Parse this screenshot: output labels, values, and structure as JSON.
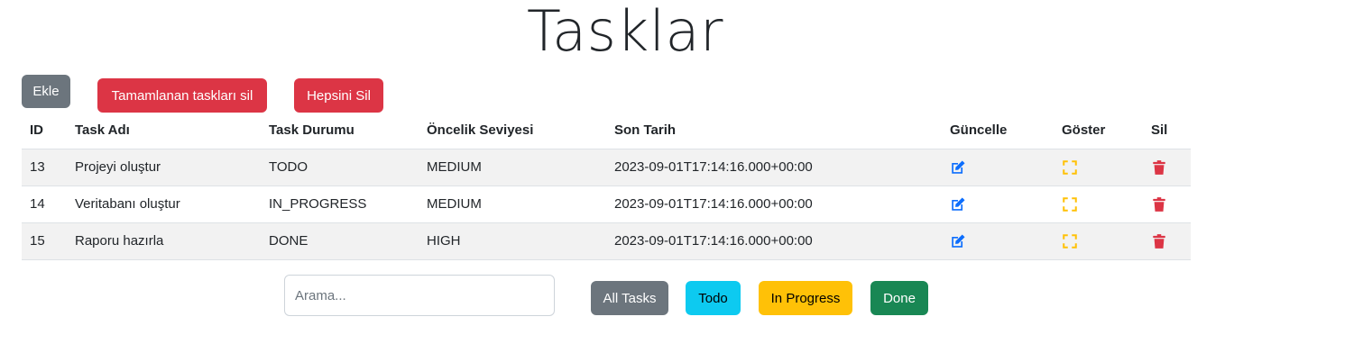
{
  "page": {
    "title": "Tasklar"
  },
  "toolbar": {
    "add_label": "Ekle",
    "delete_completed_label": "Tamamlanan taskları sil",
    "delete_all_label": "Hepsini Sil"
  },
  "table": {
    "headers": [
      "ID",
      "Task Adı",
      "Task Durumu",
      "Öncelik Seviyesi",
      "Son Tarih",
      "Güncelle",
      "Göster",
      "Sil"
    ],
    "rows": [
      {
        "id": "13",
        "name": "Projeyi oluştur",
        "status": "TODO",
        "priority": "MEDIUM",
        "due": "2023-09-01T17:14:16.000+00:00"
      },
      {
        "id": "14",
        "name": "Veritabanı oluştur",
        "status": "IN_PROGRESS",
        "priority": "MEDIUM",
        "due": "2023-09-01T17:14:16.000+00:00"
      },
      {
        "id": "15",
        "name": "Raporu hazırla",
        "status": "DONE",
        "priority": "HIGH",
        "due": "2023-09-01T17:14:16.000+00:00"
      }
    ]
  },
  "icons": {
    "update": "edit-icon",
    "show": "expand-icon",
    "delete": "trash-icon"
  },
  "search": {
    "placeholder": "Arama...",
    "value": ""
  },
  "filters": {
    "all_label": "All Tasks",
    "todo_label": "Todo",
    "in_progress_label": "In Progress",
    "done_label": "Done"
  },
  "colors": {
    "gray": "#6c757d",
    "red": "#dc3545",
    "cyan": "#0dcaf0",
    "yellow": "#ffc107",
    "green": "#198754",
    "edit_blue": "#0d6efd"
  }
}
